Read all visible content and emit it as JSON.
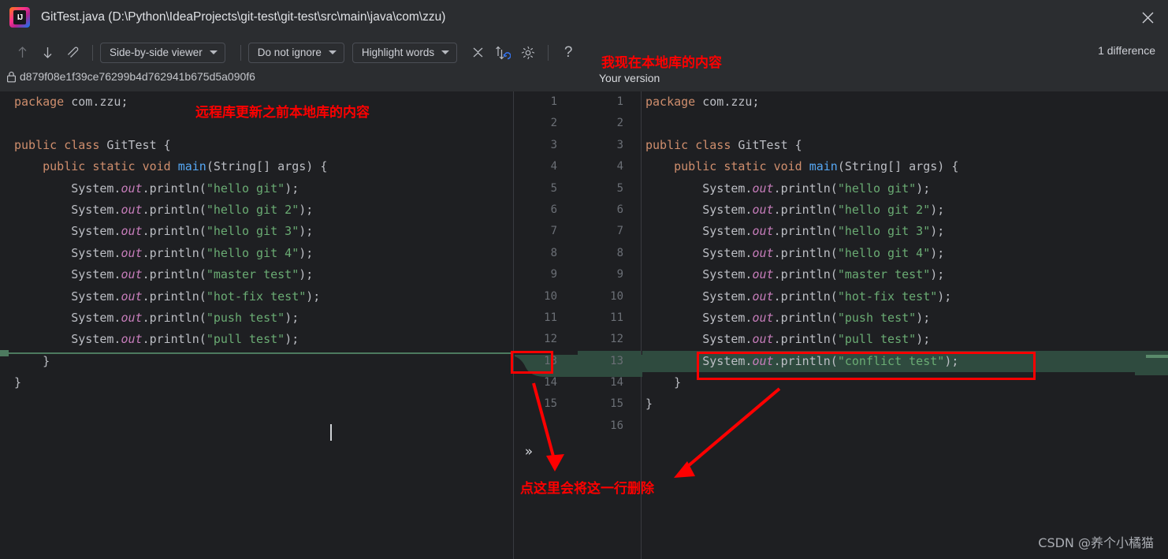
{
  "window": {
    "title": "GitTest.java (D:\\Python\\IdeaProjects\\git-test\\git-test\\src\\main\\java\\com\\zzu)",
    "app_icon": "intellij-idea-logo",
    "close_icon": "close-icon",
    "logo_mark": "IJ"
  },
  "toolbar": {
    "prev_diff_icon": "arrow-up-icon",
    "next_diff_icon": "arrow-down-icon",
    "edit_icon": "pencil-edit-icon",
    "viewer_mode": "Side-by-side viewer",
    "ignore_mode": "Do not ignore",
    "highlight_mode": "Highlight words",
    "collapse_icon": "collapse-unchanged-icon",
    "sync_scroll_icon": "sync-scroll-icon",
    "settings_icon": "gear-icon",
    "help_icon": "help-question-icon",
    "difference_count": "1 difference",
    "caret_icon": "chevron-down-icon"
  },
  "subheader": {
    "lock_icon": "lock-icon",
    "revision_hash": "d879f08e1f39ce76299b4d762941b675d5a090f6",
    "right_label": "Your version"
  },
  "annotations": {
    "left_note": "远程库更新之前本地库的内容",
    "right_note": "我现在本地库的内容",
    "bottom_note": "点这里会将这一行删除",
    "color": "#fe0000"
  },
  "watermark": "CSDN @养个小橘猫",
  "colors": {
    "background": "#2b2d30",
    "editor_background": "#1e1f22",
    "diff_added": "#2f4b3f",
    "keyword": "#cf8e6d",
    "string": "#6aab73",
    "method": "#56a8f5",
    "static_field": "#c77dbb",
    "plain": "#bcbec4",
    "line_number": "#6b6f76",
    "accent_blue": "#3574f0"
  },
  "merge_button": {
    "label": "»",
    "icon": "double-chevron-right-icon"
  },
  "left_pane": {
    "line_numbers": [
      1,
      2,
      3,
      4,
      5,
      6,
      7,
      8,
      9,
      10,
      11,
      12,
      13,
      14,
      15
    ],
    "lines": [
      {
        "n": 1,
        "tokens": [
          {
            "t": "package",
            "c": "k"
          },
          {
            "t": " com.zzu;",
            "c": "p"
          }
        ]
      },
      {
        "n": 2,
        "tokens": []
      },
      {
        "n": 3,
        "tokens": [
          {
            "t": "public",
            "c": "k"
          },
          {
            "t": " ",
            "c": "p"
          },
          {
            "t": "class",
            "c": "k"
          },
          {
            "t": " ",
            "c": "p"
          },
          {
            "t": "GitTest",
            "c": "cls"
          },
          {
            "t": " {",
            "c": "p"
          }
        ]
      },
      {
        "n": 4,
        "tokens": [
          {
            "t": "    ",
            "c": "p"
          },
          {
            "t": "public",
            "c": "k"
          },
          {
            "t": " ",
            "c": "p"
          },
          {
            "t": "static",
            "c": "k"
          },
          {
            "t": " ",
            "c": "p"
          },
          {
            "t": "void",
            "c": "k"
          },
          {
            "t": " ",
            "c": "p"
          },
          {
            "t": "main",
            "c": "m"
          },
          {
            "t": "(String[] args) {",
            "c": "p"
          }
        ]
      },
      {
        "n": 5,
        "tokens": [
          {
            "t": "        System.",
            "c": "p"
          },
          {
            "t": "out",
            "c": "f"
          },
          {
            "t": ".println(",
            "c": "p"
          },
          {
            "t": "\"hello git\"",
            "c": "s"
          },
          {
            "t": ");",
            "c": "p"
          }
        ]
      },
      {
        "n": 6,
        "tokens": [
          {
            "t": "        System.",
            "c": "p"
          },
          {
            "t": "out",
            "c": "f"
          },
          {
            "t": ".println(",
            "c": "p"
          },
          {
            "t": "\"hello git 2\"",
            "c": "s"
          },
          {
            "t": ");",
            "c": "p"
          }
        ]
      },
      {
        "n": 7,
        "tokens": [
          {
            "t": "        System.",
            "c": "p"
          },
          {
            "t": "out",
            "c": "f"
          },
          {
            "t": ".println(",
            "c": "p"
          },
          {
            "t": "\"hello git 3\"",
            "c": "s"
          },
          {
            "t": ");",
            "c": "p"
          }
        ]
      },
      {
        "n": 8,
        "tokens": [
          {
            "t": "        System.",
            "c": "p"
          },
          {
            "t": "out",
            "c": "f"
          },
          {
            "t": ".println(",
            "c": "p"
          },
          {
            "t": "\"hello git 4\"",
            "c": "s"
          },
          {
            "t": ");",
            "c": "p"
          }
        ]
      },
      {
        "n": 9,
        "tokens": [
          {
            "t": "        System.",
            "c": "p"
          },
          {
            "t": "out",
            "c": "f"
          },
          {
            "t": ".println(",
            "c": "p"
          },
          {
            "t": "\"master test\"",
            "c": "s"
          },
          {
            "t": ");",
            "c": "p"
          }
        ]
      },
      {
        "n": 10,
        "tokens": [
          {
            "t": "        System.",
            "c": "p"
          },
          {
            "t": "out",
            "c": "f"
          },
          {
            "t": ".println(",
            "c": "p"
          },
          {
            "t": "\"hot-fix test\"",
            "c": "s"
          },
          {
            "t": ");",
            "c": "p"
          }
        ]
      },
      {
        "n": 11,
        "tokens": [
          {
            "t": "        System.",
            "c": "p"
          },
          {
            "t": "out",
            "c": "f"
          },
          {
            "t": ".println(",
            "c": "p"
          },
          {
            "t": "\"push test\"",
            "c": "s"
          },
          {
            "t": ");",
            "c": "p"
          }
        ]
      },
      {
        "n": 12,
        "tokens": [
          {
            "t": "        System.",
            "c": "p"
          },
          {
            "t": "out",
            "c": "f"
          },
          {
            "t": ".println(",
            "c": "p"
          },
          {
            "t": "\"pull test\"",
            "c": "s"
          },
          {
            "t": ");",
            "c": "p"
          }
        ]
      },
      {
        "n": 13,
        "tokens": [
          {
            "t": "    }",
            "c": "p"
          }
        ]
      },
      {
        "n": 14,
        "tokens": [
          {
            "t": "}",
            "c": "p"
          }
        ]
      }
    ]
  },
  "right_pane": {
    "line_numbers": [
      1,
      2,
      3,
      4,
      5,
      6,
      7,
      8,
      9,
      10,
      11,
      12,
      13,
      14,
      15,
      16
    ],
    "lines": [
      {
        "n": 1,
        "added": false,
        "tokens": [
          {
            "t": "package",
            "c": "k"
          },
          {
            "t": " com.zzu;",
            "c": "p"
          }
        ]
      },
      {
        "n": 2,
        "added": false,
        "tokens": []
      },
      {
        "n": 3,
        "added": false,
        "tokens": [
          {
            "t": "public",
            "c": "k"
          },
          {
            "t": " ",
            "c": "p"
          },
          {
            "t": "class",
            "c": "k"
          },
          {
            "t": " ",
            "c": "p"
          },
          {
            "t": "GitTest",
            "c": "cls"
          },
          {
            "t": " {",
            "c": "p"
          }
        ]
      },
      {
        "n": 4,
        "added": false,
        "tokens": [
          {
            "t": "    ",
            "c": "p"
          },
          {
            "t": "public",
            "c": "k"
          },
          {
            "t": " ",
            "c": "p"
          },
          {
            "t": "static",
            "c": "k"
          },
          {
            "t": " ",
            "c": "p"
          },
          {
            "t": "void",
            "c": "k"
          },
          {
            "t": " ",
            "c": "p"
          },
          {
            "t": "main",
            "c": "m"
          },
          {
            "t": "(String[] args) {",
            "c": "p"
          }
        ]
      },
      {
        "n": 5,
        "added": false,
        "tokens": [
          {
            "t": "        System.",
            "c": "p"
          },
          {
            "t": "out",
            "c": "f"
          },
          {
            "t": ".println(",
            "c": "p"
          },
          {
            "t": "\"hello git\"",
            "c": "s"
          },
          {
            "t": ");",
            "c": "p"
          }
        ]
      },
      {
        "n": 6,
        "added": false,
        "tokens": [
          {
            "t": "        System.",
            "c": "p"
          },
          {
            "t": "out",
            "c": "f"
          },
          {
            "t": ".println(",
            "c": "p"
          },
          {
            "t": "\"hello git 2\"",
            "c": "s"
          },
          {
            "t": ");",
            "c": "p"
          }
        ]
      },
      {
        "n": 7,
        "added": false,
        "tokens": [
          {
            "t": "        System.",
            "c": "p"
          },
          {
            "t": "out",
            "c": "f"
          },
          {
            "t": ".println(",
            "c": "p"
          },
          {
            "t": "\"hello git 3\"",
            "c": "s"
          },
          {
            "t": ");",
            "c": "p"
          }
        ]
      },
      {
        "n": 8,
        "added": false,
        "tokens": [
          {
            "t": "        System.",
            "c": "p"
          },
          {
            "t": "out",
            "c": "f"
          },
          {
            "t": ".println(",
            "c": "p"
          },
          {
            "t": "\"hello git 4\"",
            "c": "s"
          },
          {
            "t": ");",
            "c": "p"
          }
        ]
      },
      {
        "n": 9,
        "added": false,
        "tokens": [
          {
            "t": "        System.",
            "c": "p"
          },
          {
            "t": "out",
            "c": "f"
          },
          {
            "t": ".println(",
            "c": "p"
          },
          {
            "t": "\"master test\"",
            "c": "s"
          },
          {
            "t": ");",
            "c": "p"
          }
        ]
      },
      {
        "n": 10,
        "added": false,
        "tokens": [
          {
            "t": "        System.",
            "c": "p"
          },
          {
            "t": "out",
            "c": "f"
          },
          {
            "t": ".println(",
            "c": "p"
          },
          {
            "t": "\"hot-fix test\"",
            "c": "s"
          },
          {
            "t": ");",
            "c": "p"
          }
        ]
      },
      {
        "n": 11,
        "added": false,
        "tokens": [
          {
            "t": "        System.",
            "c": "p"
          },
          {
            "t": "out",
            "c": "f"
          },
          {
            "t": ".println(",
            "c": "p"
          },
          {
            "t": "\"push test\"",
            "c": "s"
          },
          {
            "t": ");",
            "c": "p"
          }
        ]
      },
      {
        "n": 12,
        "added": false,
        "tokens": [
          {
            "t": "        System.",
            "c": "p"
          },
          {
            "t": "out",
            "c": "f"
          },
          {
            "t": ".println(",
            "c": "p"
          },
          {
            "t": "\"pull test\"",
            "c": "s"
          },
          {
            "t": ");",
            "c": "p"
          }
        ]
      },
      {
        "n": 13,
        "added": true,
        "tokens": [
          {
            "t": "        System.",
            "c": "p"
          },
          {
            "t": "out",
            "c": "f"
          },
          {
            "t": ".println(",
            "c": "p"
          },
          {
            "t": "\"conflict test\"",
            "c": "s"
          },
          {
            "t": ");",
            "c": "p"
          }
        ]
      },
      {
        "n": 14,
        "added": false,
        "tokens": [
          {
            "t": "    }",
            "c": "p"
          }
        ]
      },
      {
        "n": 15,
        "added": false,
        "tokens": [
          {
            "t": "}",
            "c": "p"
          }
        ]
      }
    ]
  }
}
